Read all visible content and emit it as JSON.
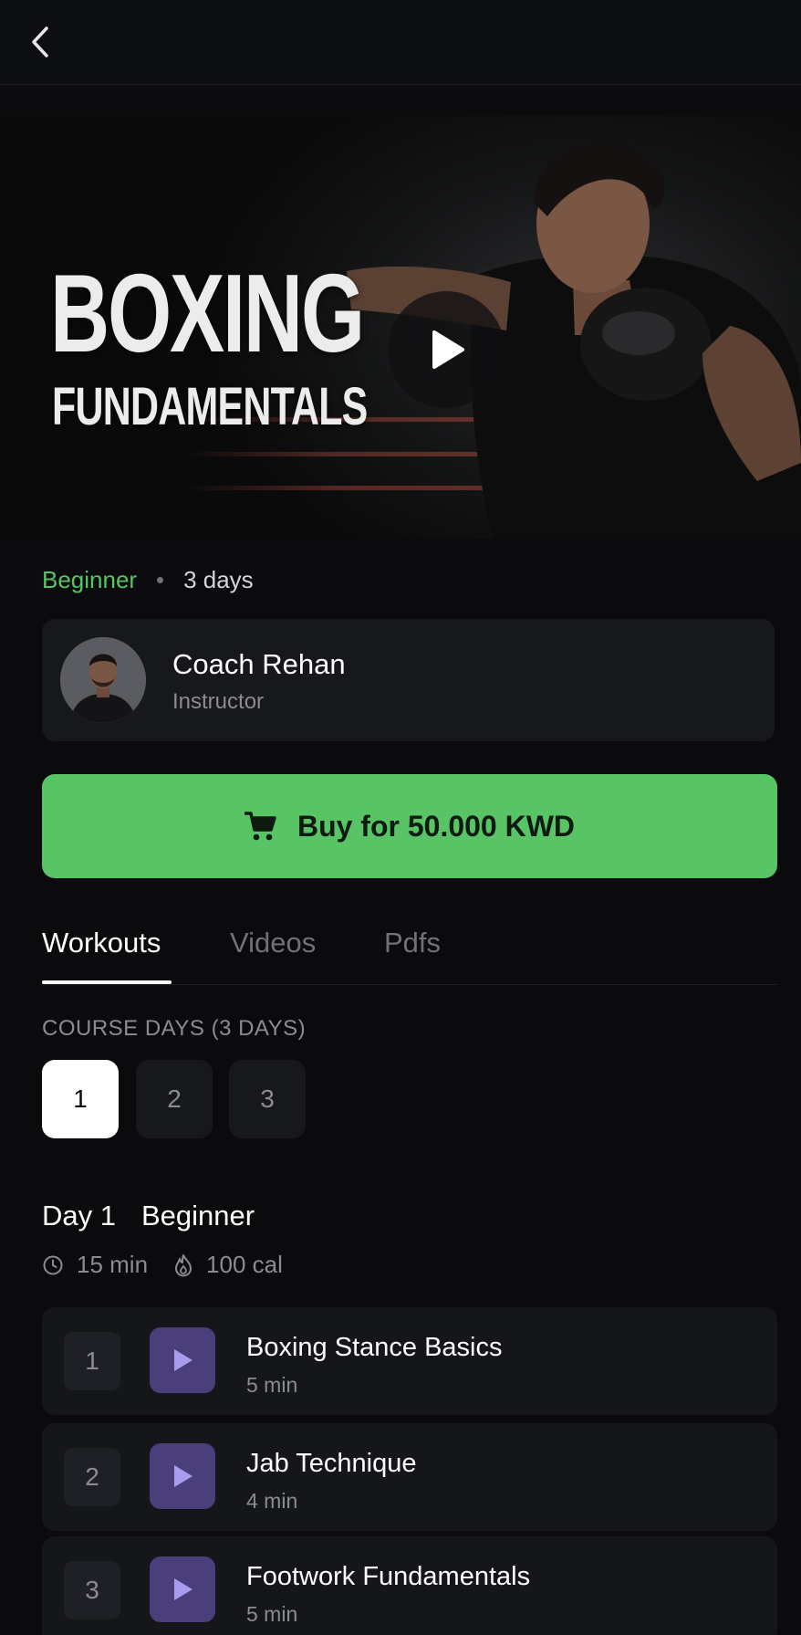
{
  "header": {
    "back_icon": "chevron-left-icon"
  },
  "hero": {
    "title_line1": "BOXING",
    "title_line2": "FUNDAMENTALS",
    "play_icon": "play-icon"
  },
  "course": {
    "level": "Beginner",
    "duration": "3 days"
  },
  "coach": {
    "name": "Coach Rehan",
    "role": "Instructor"
  },
  "buy": {
    "label": "Buy for 50.000 KWD",
    "icon": "cart-icon"
  },
  "tabs": [
    {
      "label": "Workouts",
      "active": true
    },
    {
      "label": "Videos",
      "active": false
    },
    {
      "label": "Pdfs",
      "active": false
    }
  ],
  "course_days": {
    "label": "COURSE DAYS (3 DAYS)",
    "days": [
      "1",
      "2",
      "3"
    ],
    "selected": "1"
  },
  "day_detail": {
    "day": "Day 1",
    "level": "Beginner",
    "time": "15 min",
    "calories": "100 cal"
  },
  "workouts": [
    {
      "num": "1",
      "title": "Boxing Stance Basics",
      "duration": "5 min"
    },
    {
      "num": "2",
      "title": "Jab Technique",
      "duration": "4 min"
    },
    {
      "num": "3",
      "title": "Footwork Fundamentals",
      "duration": "5 min"
    }
  ],
  "colors": {
    "accent_green": "#58c466",
    "level_green": "#56c563",
    "play_purple": "#4a3f7a",
    "play_icon_purple": "#a99cf0",
    "background": "#0b0b0d",
    "card": "#17181c"
  }
}
